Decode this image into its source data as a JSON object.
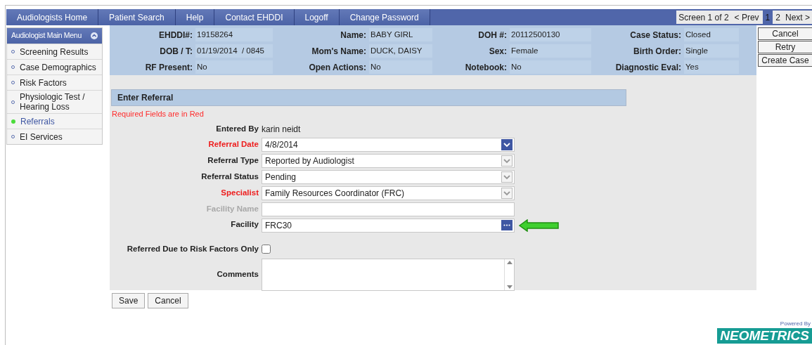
{
  "nav": {
    "items": [
      {
        "label": "Audiologists Home"
      },
      {
        "label": "Patient Search"
      },
      {
        "label": "Help"
      },
      {
        "label": "Contact EHDDI"
      },
      {
        "label": "Logoff"
      },
      {
        "label": "Change Password"
      }
    ],
    "pager": {
      "label": "Screen 1 of 2",
      "prev": "< Prev",
      "next": "Next >",
      "pages": [
        {
          "label": "1",
          "selected": true
        },
        {
          "label": "2",
          "selected": false
        }
      ]
    }
  },
  "sidebar": {
    "title": "Audiologist Main Menu",
    "items": [
      {
        "label": "Screening Results",
        "selected": false
      },
      {
        "label": "Case Demographics",
        "selected": false
      },
      {
        "label": "Risk Factors",
        "selected": false
      },
      {
        "label": "Physiologic Test / Hearing Loss",
        "selected": false
      },
      {
        "label": "Referrals",
        "selected": true
      },
      {
        "label": "EI Services",
        "selected": false
      }
    ]
  },
  "header": {
    "rows": [
      [
        {
          "label": "EHDDI#:",
          "value": "19158264"
        },
        {
          "label": "Name:",
          "value": "BABY GIRL"
        },
        {
          "label": "DOH #:",
          "value": "20112500130"
        },
        {
          "label": "Case Status:",
          "value": "Closed"
        }
      ],
      [
        {
          "label": "DOB / T:",
          "value": "01/19/2014  / 0845"
        },
        {
          "label": "Mom's Name:",
          "value": "DUCK, DAISY"
        },
        {
          "label": "Sex:",
          "value": "Female"
        },
        {
          "label": "Birth Order:",
          "value": "Single"
        }
      ],
      [
        {
          "label": "RF Present:",
          "value": "No"
        },
        {
          "label": "Open Actions:",
          "value": "No"
        },
        {
          "label": "Notebook:",
          "value": "No"
        },
        {
          "label": "Diagnostic Eval:",
          "value": "Yes"
        }
      ]
    ]
  },
  "side_buttons": [
    "Cancel",
    "Retry",
    "Create Case"
  ],
  "form": {
    "title": "Enter Referral",
    "note": "Required Fields are in Red",
    "fields": [
      {
        "kind": "text",
        "label": "Entered By",
        "value": "karin neidt",
        "required": false,
        "disabled": false
      },
      {
        "kind": "date",
        "label": "Referral Date",
        "value": "4/8/2014",
        "required": true,
        "disabled": false
      },
      {
        "kind": "select",
        "label": "Referral Type",
        "value": "Reported by Audiologist",
        "required": false,
        "disabled": false
      },
      {
        "kind": "select",
        "label": "Referral Status",
        "value": "Pending",
        "required": false,
        "disabled": false
      },
      {
        "kind": "select",
        "label": "Specialist",
        "value": "Family Resources Coordinator (FRC)",
        "required": true,
        "disabled": false
      },
      {
        "kind": "input",
        "label": "Facility Name",
        "required": false,
        "disabled": true
      },
      {
        "kind": "lookup",
        "label": "Facility",
        "value": "FRC30",
        "required": false,
        "disabled": false
      },
      {
        "kind": "checkbox",
        "label": "Referred Due to Risk Factors Only",
        "checked": false,
        "required": false,
        "disabled": false
      },
      {
        "kind": "textarea",
        "label": "Comments",
        "required": false,
        "disabled": false
      }
    ],
    "actions": [
      "Save",
      "Cancel"
    ]
  },
  "footer": {
    "powered_by": "Powered By",
    "logo": "NEOMETRICS"
  }
}
